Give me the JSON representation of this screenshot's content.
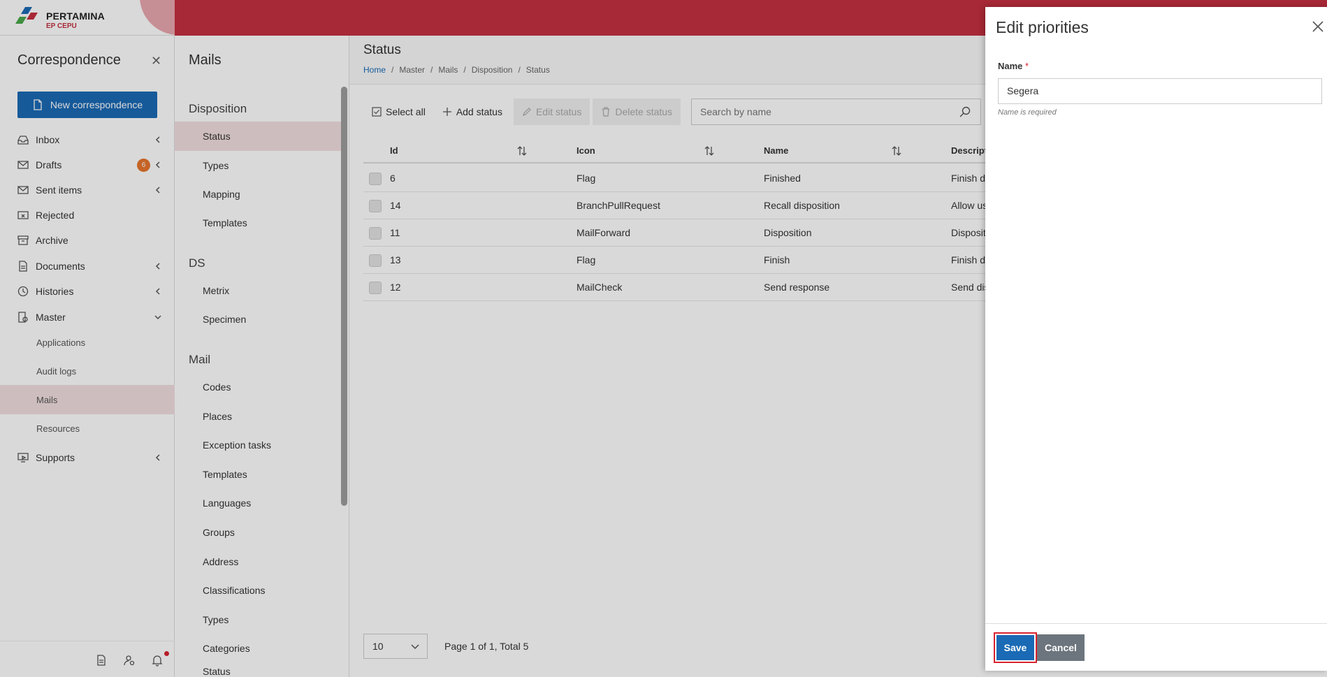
{
  "brand": {
    "name": "PERTAMINA",
    "unit": "EP CEPU"
  },
  "sidebar": {
    "title": "Correspondence",
    "new_button": "New correspondence",
    "items": [
      {
        "label": "Inbox"
      },
      {
        "label": "Drafts",
        "badge": "6"
      },
      {
        "label": "Sent items"
      },
      {
        "label": "Rejected"
      },
      {
        "label": "Archive"
      },
      {
        "label": "Documents"
      },
      {
        "label": "Histories"
      },
      {
        "label": "Master"
      },
      {
        "label": "Applications"
      },
      {
        "label": "Audit logs"
      },
      {
        "label": "Mails"
      },
      {
        "label": "Resources"
      },
      {
        "label": "Supports"
      }
    ]
  },
  "mails": {
    "title": "Mails",
    "sections": [
      "Disposition",
      "DS",
      "Mail"
    ],
    "disposition": [
      "Status",
      "Types",
      "Mapping",
      "Templates"
    ],
    "ds": [
      "Metrix",
      "Specimen"
    ],
    "mail": [
      "Codes",
      "Places",
      "Exception tasks",
      "Templates",
      "Languages",
      "Groups",
      "Address",
      "Classifications",
      "Types",
      "Categories",
      "Status"
    ]
  },
  "main": {
    "title": "Status",
    "breadcrumb": [
      "Home",
      "Master",
      "Mails",
      "Disposition",
      "Status"
    ],
    "toolbar": {
      "select_all": "Select all",
      "add": "Add status",
      "edit": "Edit status",
      "delete": "Delete status",
      "search_placeholder": "Search by name"
    },
    "columns": [
      "Id",
      "Icon",
      "Name",
      "Descript"
    ],
    "rows": [
      {
        "id": "6",
        "icon": "Flag",
        "name": "Finished",
        "desc": "Finish d"
      },
      {
        "id": "14",
        "icon": "BranchPullRequest",
        "name": "Recall disposition",
        "desc": "Allow us"
      },
      {
        "id": "11",
        "icon": "MailForward",
        "name": "Disposition",
        "desc": "Disposit"
      },
      {
        "id": "13",
        "icon": "Flag",
        "name": "Finish",
        "desc": "Finish d"
      },
      {
        "id": "12",
        "icon": "MailCheck",
        "name": "Send response",
        "desc": "Send dis"
      }
    ],
    "page_size": "10",
    "pager": "Page 1 of 1, Total 5"
  },
  "drawer": {
    "title": "Edit priorities",
    "name_label": "Name",
    "required_mark": "*",
    "name_value": "Segera",
    "hint": "Name is required",
    "save": "Save",
    "cancel": "Cancel"
  },
  "colors": {
    "brand_red": "#c53040",
    "primary": "#1a6ab5",
    "badge": "#e8762d",
    "selected_bg": "#f2dfe1"
  }
}
